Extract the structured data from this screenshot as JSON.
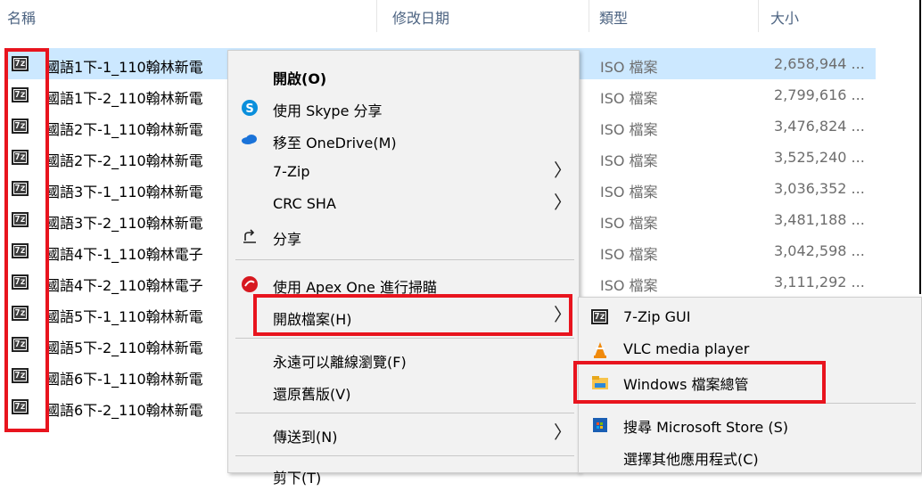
{
  "header": {
    "columns": [
      "名稱",
      "修改日期",
      "類型",
      "大小"
    ]
  },
  "files": [
    {
      "name": "國語1下-1_110翰林新電",
      "type": "ISO 檔案",
      "size": "2,658,944 ...",
      "selected": true
    },
    {
      "name": "國語1下-2_110翰林新電",
      "type": "ISO 檔案",
      "size": "2,799,616 ..."
    },
    {
      "name": "國語2下-1_110翰林新電",
      "type": "ISO 檔案",
      "size": "3,476,824 ..."
    },
    {
      "name": "國語2下-2_110翰林新電",
      "type": "ISO 檔案",
      "size": "3,525,240 ..."
    },
    {
      "name": "國語3下-1_110翰林新電",
      "type": "ISO 檔案",
      "size": "3,036,352 ..."
    },
    {
      "name": "國語3下-2_110翰林新電",
      "type": "ISO 檔案",
      "size": "3,481,188 ..."
    },
    {
      "name": "國語4下-1_110翰林電子",
      "type": "ISO 檔案",
      "size": "3,042,598 ..."
    },
    {
      "name": "國語4下-2_110翰林電子",
      "type": "ISO 檔案",
      "size": "3,111,292 ..."
    },
    {
      "name": "國語5下-1_110翰林新電",
      "type": "",
      "size": ""
    },
    {
      "name": "國語5下-2_110翰林新電",
      "type": "",
      "size": ""
    },
    {
      "name": "國語6下-1_110翰林新電",
      "type": "",
      "size": ""
    },
    {
      "name": "國語6下-2_110翰林新電",
      "type": "",
      "size": ""
    }
  ],
  "file_icon_text": "7z",
  "context_menu": {
    "items": [
      {
        "label": "開啟(O)",
        "icon": "none",
        "bold": true
      },
      {
        "label": "使用 Skype 分享",
        "icon": "skype-icon"
      },
      {
        "label": "移至 OneDrive(M)",
        "icon": "onedrive-icon"
      },
      {
        "label": "7-Zip",
        "icon": "none",
        "submenu": true
      },
      {
        "label": "CRC SHA",
        "icon": "none",
        "submenu": true
      },
      {
        "label": "分享",
        "icon": "share-icon"
      },
      {
        "label": "使用 Apex One 進行掃瞄",
        "icon": "apex-one-icon"
      },
      {
        "label": "開啟檔案(H)",
        "icon": "none",
        "submenu": true
      },
      {
        "label": "永遠可以離線瀏覽(F)",
        "icon": "none"
      },
      {
        "label": "還原舊版(V)",
        "icon": "none"
      },
      {
        "label": "傳送到(N)",
        "icon": "none",
        "submenu": true
      },
      {
        "label": "剪下(T)",
        "icon": "none"
      }
    ],
    "arrow_glyph": "〉"
  },
  "submenu": {
    "items": [
      {
        "label": "7-Zip GUI",
        "icon": "7zip-icon"
      },
      {
        "label": "VLC media player",
        "icon": "vlc-icon"
      },
      {
        "label": "Windows 檔案總管",
        "icon": "file-explorer-icon"
      },
      {
        "label": "搜尋 Microsoft Store (S)",
        "icon": "microsoft-store-icon"
      },
      {
        "label": "選擇其他應用程式(C)",
        "icon": "none"
      }
    ]
  },
  "colors": {
    "highlight_red": "#e8141e",
    "selection_blue": "#cce8ff",
    "menu_bg": "#f2f2f2"
  }
}
